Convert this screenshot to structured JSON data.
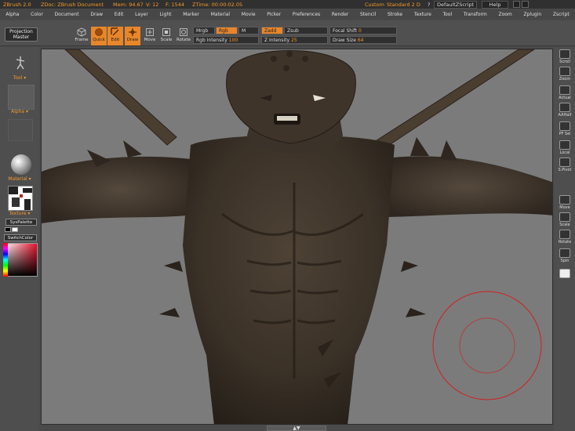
{
  "status": {
    "app": "ZBrush 2.0",
    "doc": "ZDoc: ZBrush Document",
    "mem": "Mem: 94.67",
    "vram": "V: 12",
    "free": "F: 1544",
    "ztime": "ZTime: 00:00:02.05",
    "custom": "Custom",
    "standard": "Standard 2 D",
    "question": "?",
    "zscript_btn": "DefaultZScript",
    "help_btn": "Help"
  },
  "menu": [
    "Alpha",
    "Color",
    "Document",
    "Draw",
    "Edit",
    "Layer",
    "Light",
    "Marker",
    "Material",
    "Movie",
    "Picker",
    "Preferences",
    "Render",
    "Stencil",
    "Stroke",
    "Texture",
    "Tool",
    "Transform",
    "Zoom",
    "Zplugin",
    "Zscript"
  ],
  "toolbar": {
    "projection_master": "Projection Master",
    "frame": "Frame",
    "quick": "Quick",
    "edit": "Edit",
    "draw": "Draw",
    "move": "Move",
    "scale": "Scale",
    "rotate": "Rotate",
    "mrgb": "Mrgb",
    "rgb": "Rgb",
    "m": "M",
    "zadd": "Zadd",
    "zsub": "Zsub",
    "rgb_intensity_label": "Rgb Intensity",
    "rgb_intensity_value": "100",
    "z_intensity_label": "Z Intensity",
    "z_intensity_value": "25",
    "focal_shift_label": "Focal Shift",
    "focal_shift_value": "0",
    "draw_size_label": "Draw Size",
    "draw_size_value": "64"
  },
  "left": {
    "tool": "Tool",
    "alpha": "Alpha",
    "material": "Material",
    "texture": "Texture",
    "syspalette": "SysPalette",
    "switchcolor": "SwitchColor"
  },
  "right": [
    "Scroll",
    "Zoom",
    "Actual",
    "AAHalf",
    "PF Sel",
    "Local",
    "S.Pivot",
    "Move",
    "Scale",
    "Rotate",
    "Spin"
  ],
  "colors": {
    "accent": "#e8862a",
    "brush_circle": "#d02020",
    "viewport_bg": "#7b7b7b"
  }
}
